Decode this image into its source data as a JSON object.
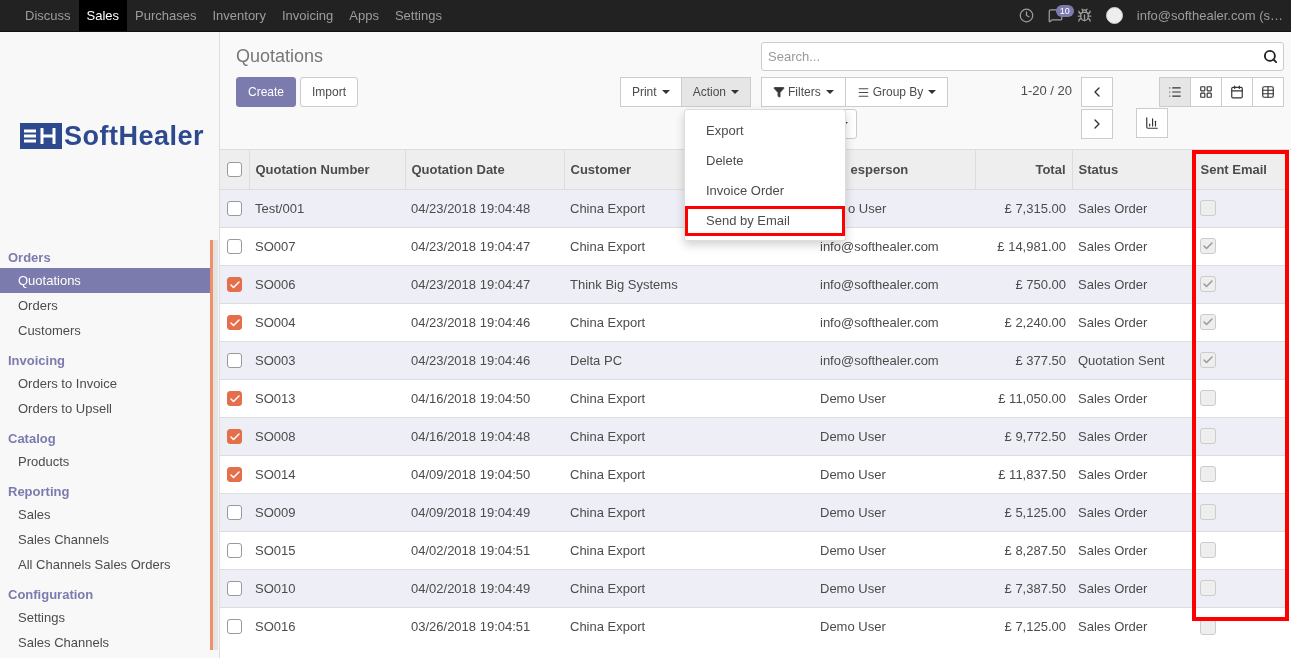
{
  "top_menu": [
    {
      "label": "Discuss",
      "selected": false
    },
    {
      "label": "Sales",
      "selected": true
    },
    {
      "label": "Purchases",
      "selected": false
    },
    {
      "label": "Inventory",
      "selected": false
    },
    {
      "label": "Invoicing",
      "selected": false
    },
    {
      "label": "Apps",
      "selected": false
    },
    {
      "label": "Settings",
      "selected": false
    }
  ],
  "systray": {
    "chat_count": "10",
    "user": "info@softhealer.com (s…"
  },
  "logo": "SoftHealer",
  "sidebar": [
    {
      "title": "Orders",
      "items": [
        {
          "label": "Quotations",
          "selected": true
        },
        {
          "label": "Orders",
          "selected": false
        },
        {
          "label": "Customers",
          "selected": false
        }
      ]
    },
    {
      "title": "Invoicing",
      "items": [
        {
          "label": "Orders to Invoice",
          "selected": false
        },
        {
          "label": "Orders to Upsell",
          "selected": false
        }
      ]
    },
    {
      "title": "Catalog",
      "items": [
        {
          "label": "Products",
          "selected": false
        }
      ]
    },
    {
      "title": "Reporting",
      "items": [
        {
          "label": "Sales",
          "selected": false
        },
        {
          "label": "Sales Channels",
          "selected": false
        },
        {
          "label": "All Channels Sales Orders",
          "selected": false
        }
      ]
    },
    {
      "title": "Configuration",
      "items": [
        {
          "label": "Settings",
          "selected": false
        },
        {
          "label": "Sales Channels",
          "selected": false
        }
      ]
    }
  ],
  "page_title": "Quotations",
  "buttons": {
    "create": "Create",
    "import": "Import",
    "print": "Print",
    "action": "Action",
    "filters": "Filters",
    "group_by": "Group By"
  },
  "action_menu": [
    {
      "label": "Export",
      "highlighted": false
    },
    {
      "label": "Delete",
      "highlighted": false
    },
    {
      "label": "Invoice Order",
      "highlighted": false
    },
    {
      "label": "Send by Email",
      "highlighted": true
    }
  ],
  "search": {
    "placeholder": "Search..."
  },
  "pager": "1-20 / 20",
  "views": [
    {
      "kind": "list",
      "selected": true
    },
    {
      "kind": "kanban",
      "selected": false
    },
    {
      "kind": "calendar",
      "selected": false
    },
    {
      "kind": "pivot",
      "selected": false
    },
    {
      "kind": "graph",
      "selected": false
    }
  ],
  "table": {
    "all_selected": false,
    "columns": [
      {
        "label": "Quotation Number",
        "highlighted": false
      },
      {
        "label": "Quotation Date",
        "highlighted": false
      },
      {
        "label": "Customer",
        "highlighted": false
      },
      {
        "label": "esperson",
        "highlighted": false
      },
      {
        "label": "Total",
        "highlighted": false
      },
      {
        "label": "Status",
        "highlighted": false
      },
      {
        "label": "Sent Email",
        "highlighted": true
      }
    ],
    "rows": [
      {
        "selected": false,
        "number": "Test/001",
        "date": "04/23/2018 19:04:48",
        "customer": "China Export",
        "salesperson": "o User",
        "total": "£ 7,315.00",
        "status": "Sales Order",
        "sent": false
      },
      {
        "selected": false,
        "number": "SO007",
        "date": "04/23/2018 19:04:47",
        "customer": "China Export",
        "salesperson": "info@softhealer.com",
        "total": "£ 14,981.00",
        "status": "Sales Order",
        "sent": true
      },
      {
        "selected": true,
        "number": "SO006",
        "date": "04/23/2018 19:04:47",
        "customer": "Think Big Systems",
        "salesperson": "info@softhealer.com",
        "total": "£ 750.00",
        "status": "Sales Order",
        "sent": true
      },
      {
        "selected": true,
        "number": "SO004",
        "date": "04/23/2018 19:04:46",
        "customer": "China Export",
        "salesperson": "info@softhealer.com",
        "total": "£ 2,240.00",
        "status": "Sales Order",
        "sent": true
      },
      {
        "selected": false,
        "number": "SO003",
        "date": "04/23/2018 19:04:46",
        "customer": "Delta PC",
        "salesperson": "info@softhealer.com",
        "total": "£ 377.50",
        "status": "Quotation Sent",
        "sent": true
      },
      {
        "selected": true,
        "number": "SO013",
        "date": "04/16/2018 19:04:50",
        "customer": "China Export",
        "salesperson": "Demo User",
        "total": "£ 11,050.00",
        "status": "Sales Order",
        "sent": false
      },
      {
        "selected": true,
        "number": "SO008",
        "date": "04/16/2018 19:04:48",
        "customer": "China Export",
        "salesperson": "Demo User",
        "total": "£ 9,772.50",
        "status": "Sales Order",
        "sent": false
      },
      {
        "selected": true,
        "number": "SO014",
        "date": "04/09/2018 19:04:50",
        "customer": "China Export",
        "salesperson": "Demo User",
        "total": "£ 11,837.50",
        "status": "Sales Order",
        "sent": false
      },
      {
        "selected": false,
        "number": "SO009",
        "date": "04/09/2018 19:04:49",
        "customer": "China Export",
        "salesperson": "Demo User",
        "total": "£ 5,125.00",
        "status": "Sales Order",
        "sent": false
      },
      {
        "selected": false,
        "number": "SO015",
        "date": "04/02/2018 19:04:51",
        "customer": "China Export",
        "salesperson": "Demo User",
        "total": "£ 8,287.50",
        "status": "Sales Order",
        "sent": false
      },
      {
        "selected": false,
        "number": "SO010",
        "date": "04/02/2018 19:04:49",
        "customer": "China Export",
        "salesperson": "Demo User",
        "total": "£ 7,387.50",
        "status": "Sales Order",
        "sent": false
      },
      {
        "selected": false,
        "number": "SO016",
        "date": "03/26/2018 19:04:51",
        "customer": "China Export",
        "salesperson": "Demo User",
        "total": "£ 7,125.00",
        "status": "Sales Order",
        "sent": false
      }
    ]
  }
}
